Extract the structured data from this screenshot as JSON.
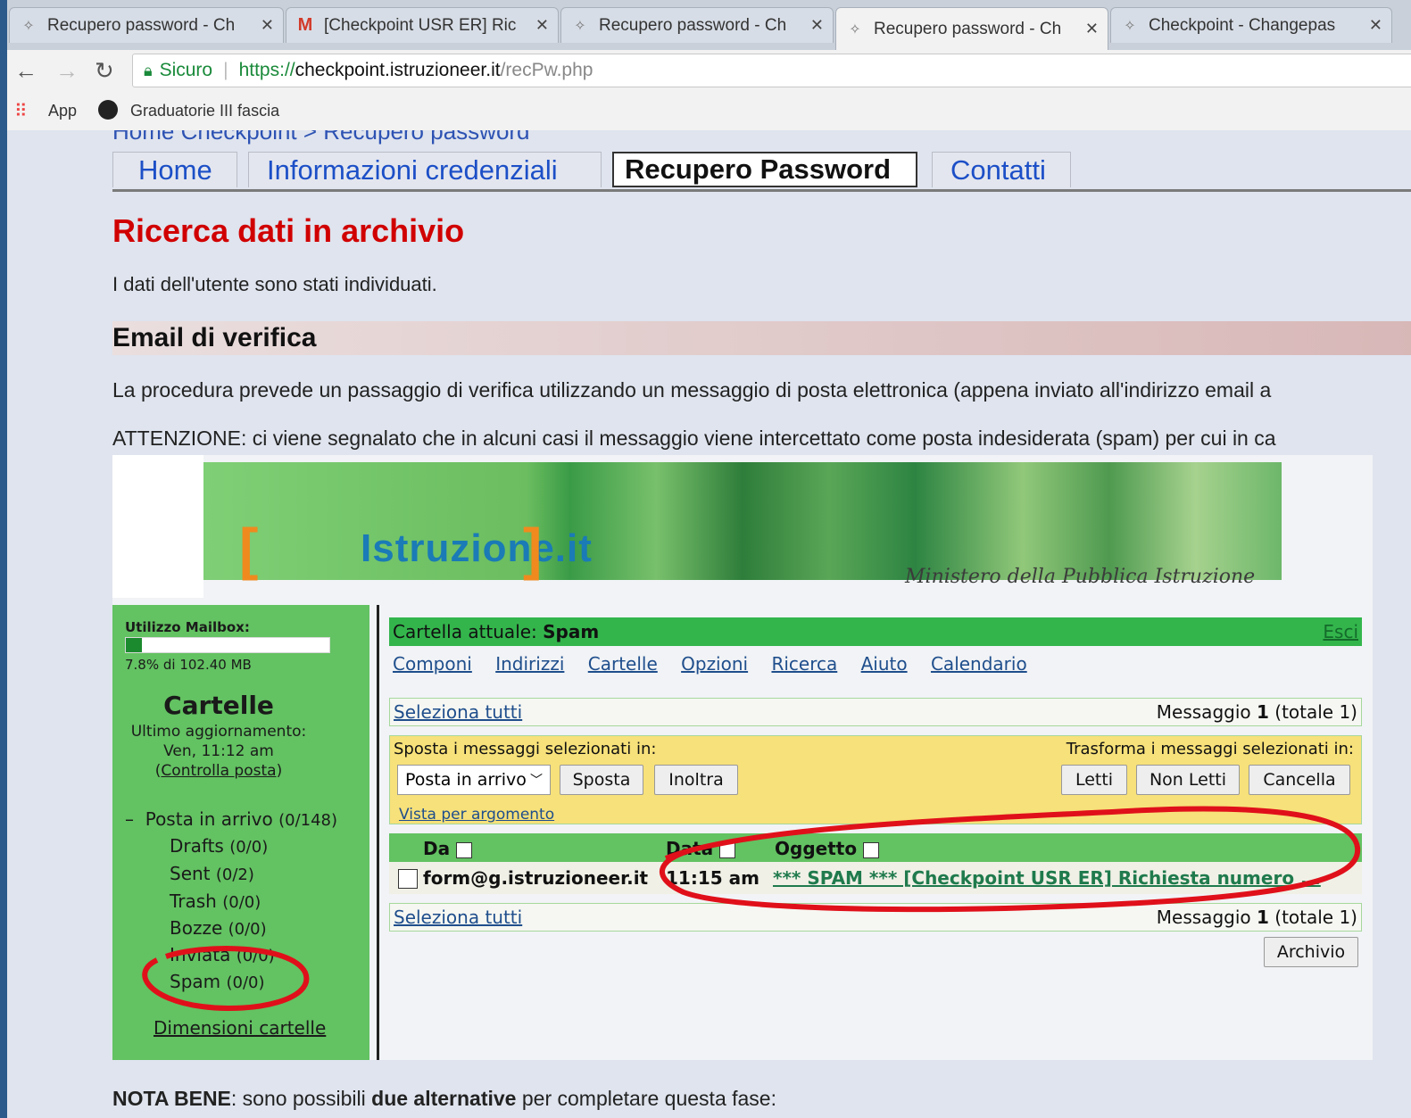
{
  "browser": {
    "tabs": [
      {
        "title": "Recupero password - Ch",
        "icon": "checkpoint-icon"
      },
      {
        "title": "[Checkpoint USR ER] Ric",
        "icon": "gmail-icon"
      },
      {
        "title": "Recupero password - Ch",
        "icon": "checkpoint-icon"
      },
      {
        "title": "Recupero password - Ch",
        "icon": "checkpoint-icon"
      },
      {
        "title": "Checkpoint - Changepas",
        "icon": "checkpoint-icon"
      }
    ],
    "secure_label": "Sicuro",
    "url_scheme": "https://",
    "url_host": "checkpoint.istruzioneer.it",
    "url_path": "/recPw.php",
    "bookmarks": [
      {
        "label": "App",
        "icon": "apps-grid-icon"
      },
      {
        "label": "Graduatorie III fascia",
        "icon": "site-icon"
      }
    ]
  },
  "page": {
    "breadcrumb": "Home Checkpoint > Recupero password",
    "menu": [
      "Home",
      "Informazioni credenziali",
      "Recupero Password",
      "Contatti"
    ],
    "heading": "Ricerca dati in archivio",
    "intro": "I dati dell'utente sono stati individuati.",
    "section_title": "Email di verifica",
    "para1": "La procedura prevede un passaggio di verifica utilizzando un messaggio di posta elettronica (appena inviato all'indirizzo email a",
    "para2": "ATTENZIONE: ci viene segnalato che in alcuni casi il messaggio viene intercettato come posta indesiderata (spam) per cui in ca",
    "nota_bold1": "NOTA BENE",
    "nota_text1": ": sono possibili ",
    "nota_bold2": "due alternative",
    "nota_text2": " per completare questa fase:"
  },
  "webmail": {
    "logo_text": "Istruzione.it",
    "ministero": "Ministero della Pubblica Istruzione",
    "usage_label": "Utilizzo Mailbox:",
    "usage_fraction": 0.078,
    "usage_text": "7.8% di 102.40 MB",
    "cartelle_title": "Cartelle",
    "last_update_label": "Ultimo aggiornamento:",
    "last_update_value": "Ven, 11:12 am",
    "check_mail": "Controlla posta",
    "folders": [
      {
        "name": "Posta in arrivo",
        "count": "(0/148)",
        "prefix": "–"
      },
      {
        "name": "Drafts",
        "count": "(0/0)"
      },
      {
        "name": "Sent",
        "count": "(0/2)"
      },
      {
        "name": "Trash",
        "count": "(0/0)"
      },
      {
        "name": "Bozze",
        "count": "(0/0)"
      },
      {
        "name": "Inviata",
        "count": "(0/0)"
      },
      {
        "name": "Spam",
        "count": "(0/0)"
      }
    ],
    "folder_sizes": "Dimensioni cartelle",
    "current_folder_label": "Cartella attuale: ",
    "current_folder": "Spam",
    "esci": "Esci",
    "nav": [
      "Componi",
      "Indirizzi",
      "Cartelle",
      "Opzioni",
      "Ricerca",
      "Aiuto",
      "Calendario"
    ],
    "select_all": "Seleziona tutti",
    "msg_label": "Messaggio ",
    "msg_num": "1",
    "msg_total": " (totale 1)",
    "move_label": "Sposta i messaggi selezionati in:",
    "transform_label": "Trasforma i messaggi selezionati in:",
    "move_target": "Posta in arrivo",
    "btn_sposta": "Sposta",
    "btn_inoltra": "Inoltra",
    "btn_letti": "Letti",
    "btn_non_letti": "Non Letti",
    "btn_cancella": "Cancella",
    "vista_argomento": "Vista per argomento",
    "col_da": "Da",
    "col_data": "Data",
    "col_oggetto": "Oggetto",
    "row_from": "form@g.istruzioneer.it",
    "row_time": "11:15 am",
    "row_subject": "*** SPAM *** [Checkpoint USR ER] Richiesta numero ...",
    "btn_archivio": "Archivio"
  },
  "colors": {
    "heading_red": "#d10000",
    "link_blue": "#1c4fc7",
    "mail_green": "#63c262",
    "annotation_red": "#e0101a"
  }
}
